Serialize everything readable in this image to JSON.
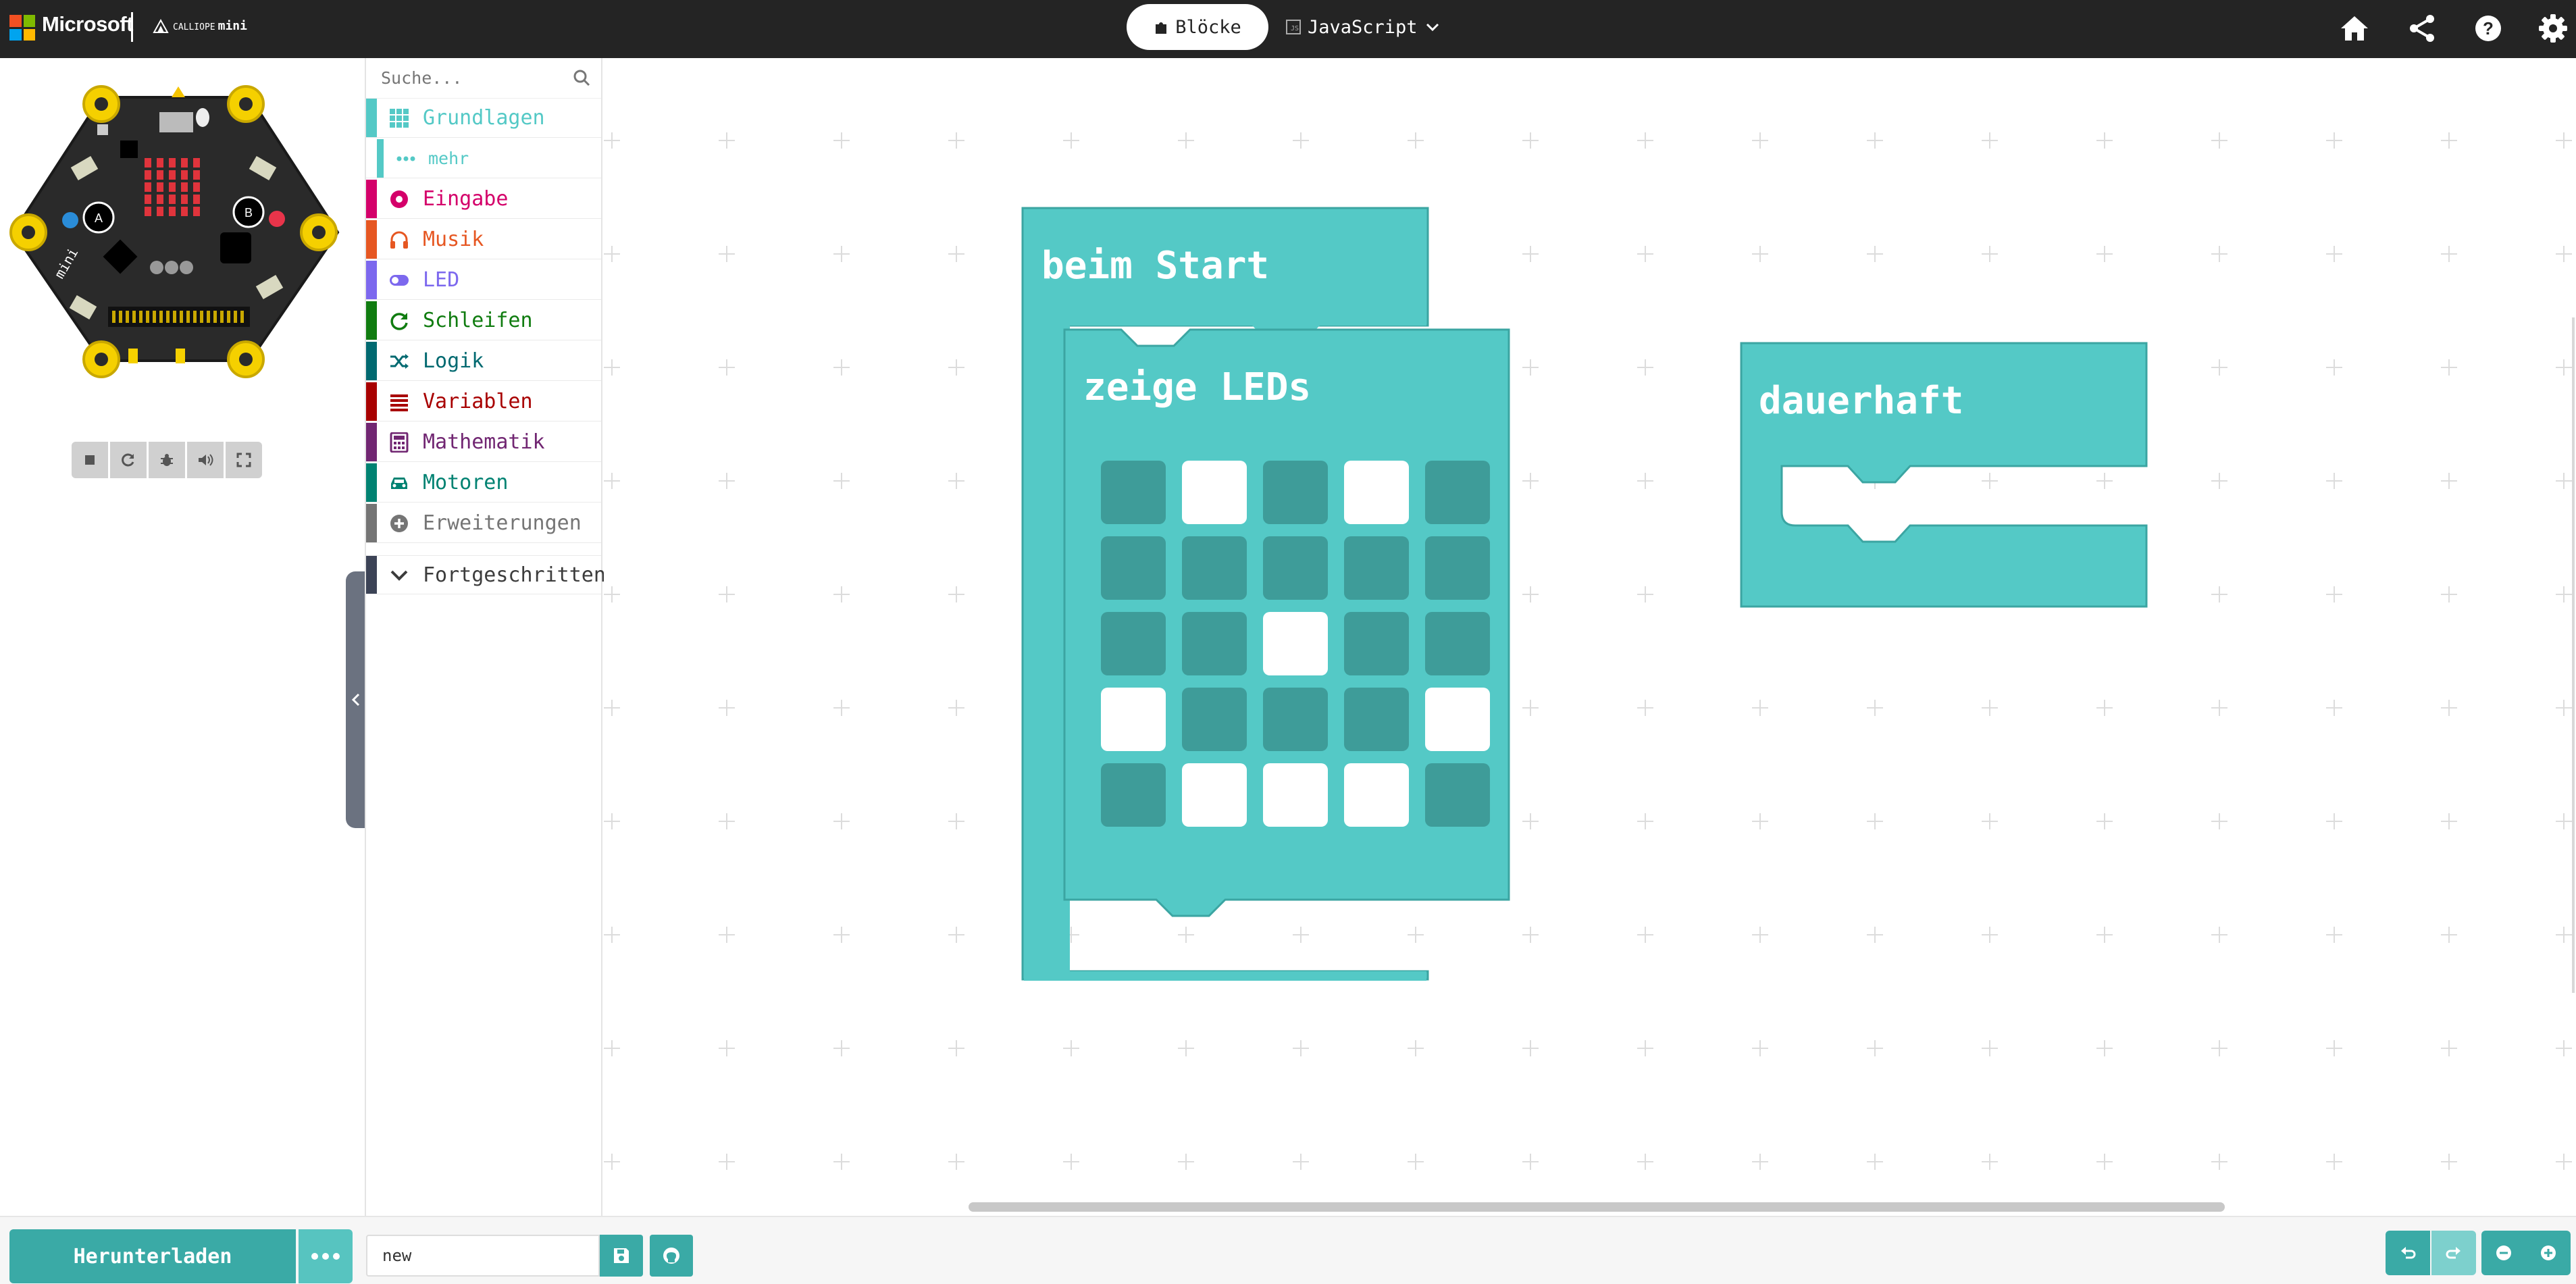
{
  "header": {
    "brand": "Microsoft",
    "product_small": "CALLIOPE",
    "product": "mini",
    "tab_blocks": "Blöcke",
    "tab_js": "JavaScript",
    "js_icon_text": "JS"
  },
  "toolbox": {
    "search_placeholder": "Suche...",
    "categories": [
      {
        "label": "Grundlagen",
        "color": "#54C9C6"
      },
      {
        "label": "mehr",
        "color": "#54C9C6"
      },
      {
        "label": "Eingabe",
        "color": "#D4006A"
      },
      {
        "label": "Musik",
        "color": "#E65722"
      },
      {
        "label": "LED",
        "color": "#7C68EE"
      },
      {
        "label": "Schleifen",
        "color": "#107C10"
      },
      {
        "label": "Logik",
        "color": "#006970"
      },
      {
        "label": "Variablen",
        "color": "#A80000"
      },
      {
        "label": "Mathematik",
        "color": "#712672"
      },
      {
        "label": "Motoren",
        "color": "#008272"
      },
      {
        "label": "Erweiterungen",
        "color": "#757575"
      },
      {
        "label": "Fortgeschritten",
        "color": "#3C3C3C"
      }
    ]
  },
  "workspace": {
    "block_on_start": "beim Start",
    "block_show_leds": "zeige LEDs",
    "block_forever": "dauerhaft",
    "led_grid": [
      [
        0,
        1,
        0,
        1,
        0
      ],
      [
        0,
        0,
        0,
        0,
        0
      ],
      [
        0,
        0,
        1,
        0,
        0
      ],
      [
        1,
        0,
        0,
        0,
        1
      ],
      [
        0,
        1,
        1,
        1,
        0
      ]
    ],
    "block_color": "#54C9C6",
    "block_stroke": "#3BA5A2",
    "led_off_color": "#3E9C99"
  },
  "footer": {
    "download_label": "Herunterladen",
    "project_name": "new"
  }
}
